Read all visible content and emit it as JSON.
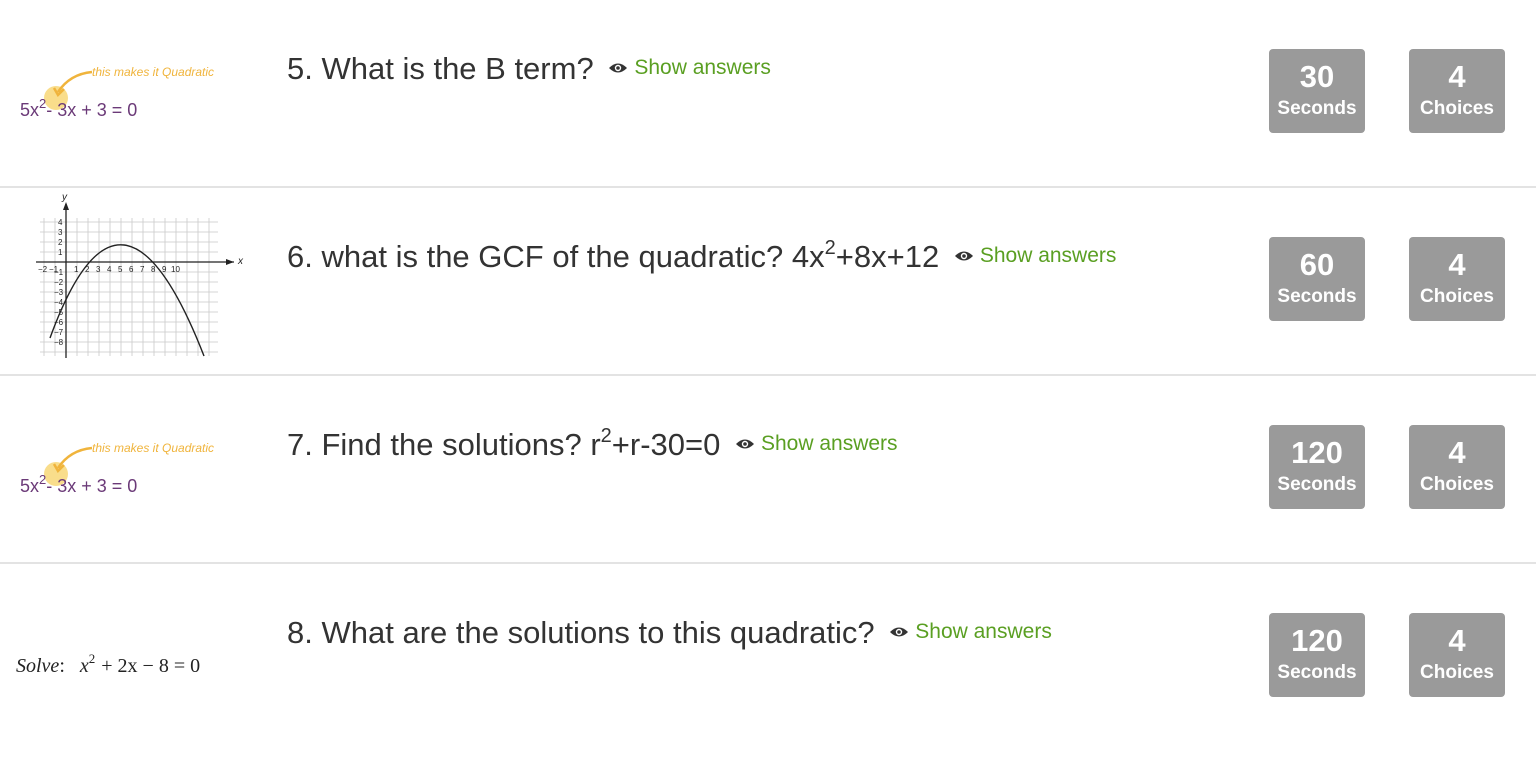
{
  "questions": [
    {
      "number": "5.",
      "text": "What is the B term?",
      "show_answers": "Show answers",
      "seconds_value": "30",
      "seconds_label": "Seconds",
      "choices_value": "4",
      "choices_label": "Choices",
      "thumbnail": {
        "note": "this makes it Quadratic",
        "eq_base": "5x",
        "eq_exp": "2",
        "eq_rest": "- 3x + 3 = 0"
      }
    },
    {
      "number": "6.",
      "text": "what is the GCF of the quadratic? 4x",
      "text_sup": "2",
      "text_after": "+8x+12",
      "show_answers": "Show answers",
      "seconds_value": "60",
      "seconds_label": "Seconds",
      "choices_value": "4",
      "choices_label": "Choices",
      "thumbnail": {
        "x_axis_label": "x",
        "y_axis_label": "y",
        "x_ticks": [
          "−2",
          "−1",
          "1",
          "2",
          "3",
          "4",
          "5",
          "6",
          "7",
          "8",
          "9",
          "10"
        ],
        "y_ticks": [
          "4",
          "3",
          "2",
          "1",
          "−1",
          "−2",
          "−3",
          "−4",
          "−5",
          "−6",
          "−7",
          "−8"
        ]
      }
    },
    {
      "number": "7.",
      "text": "Find the solutions?  r",
      "text_sup": "2",
      "text_after": "+r-30=0",
      "show_answers": "Show answers",
      "seconds_value": "120",
      "seconds_label": "Seconds",
      "choices_value": "4",
      "choices_label": "Choices",
      "thumbnail": {
        "note": "this makes it Quadratic",
        "eq_base": "5x",
        "eq_exp": "2",
        "eq_rest": "- 3x + 3 = 0"
      }
    },
    {
      "number": "8.",
      "text": "What are the solutions to this quadratic?",
      "show_answers": "Show answers",
      "seconds_value": "120",
      "seconds_label": "Seconds",
      "choices_value": "4",
      "choices_label": "Choices",
      "thumbnail": {
        "solve_label": "Solve",
        "eq_x": "x",
        "eq_exp": "2",
        "eq_rest": "+ 2x − 8 = 0"
      }
    }
  ],
  "colors": {
    "accent_green": "#5a9f22",
    "badge_gray": "#9a9a9a",
    "divider": "#e3e3e3",
    "eq_purple": "#6b3a78",
    "note_orange": "#f0b43c"
  },
  "icons": {
    "show_answers": "eye-icon"
  }
}
